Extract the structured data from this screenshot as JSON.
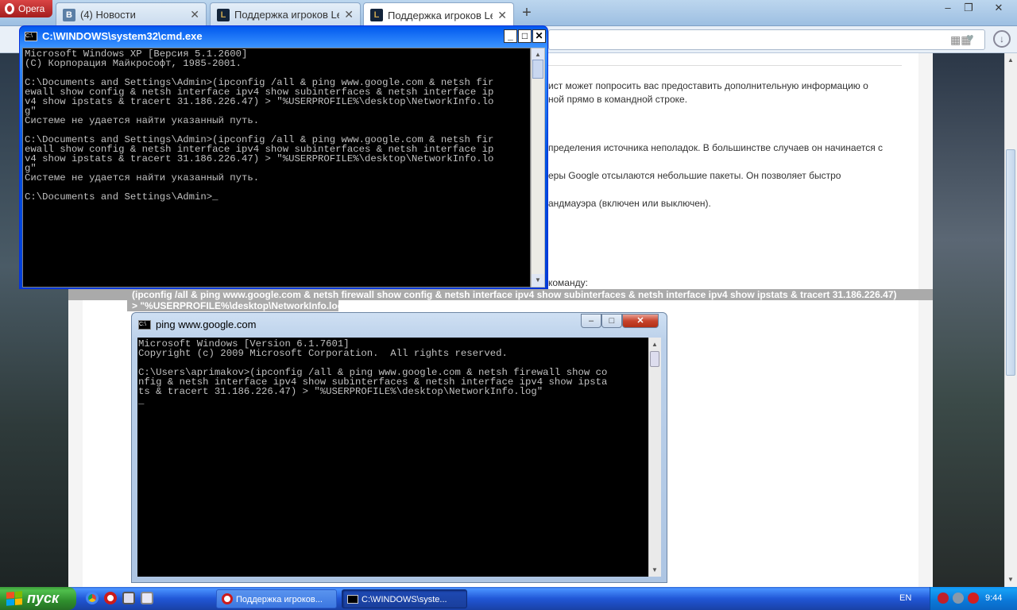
{
  "browser": {
    "menu_label": "Opera",
    "tabs": [
      {
        "title": "(4) Новости",
        "favicon": "В"
      },
      {
        "title": "Поддержка игроков Leag",
        "favicon": "L"
      },
      {
        "title": "Поддержка игроков Leag",
        "favicon": "L"
      }
    ],
    "close_glyph": "✕",
    "new_tab_glyph": "+",
    "window_controls": {
      "minimize": "–",
      "maximize": "❐",
      "close": "✕"
    }
  },
  "page": {
    "paragraphs": [
      "ист может попросить вас предоставить дополнительную информацию о",
      "ной прямо в командной строке.",
      "пределения источника неполадок. В большинстве случаев он начинается с",
      "еры Google отсылаются небольшие пакеты. Он позволяет быстро",
      "андмауэра (включен или выключен).",
      "команду:"
    ],
    "command_line1": "(ipconfig /all & ping www.google.com & netsh firewall show config & netsh interface ipv4 show subinterfaces & netsh interface ipv4 show ipstats & tracert 31.186.226.47)",
    "command_line2": "> \"%USERPROFILE%\\desktop\\NetworkInfo.log\""
  },
  "xp_window": {
    "title": "C:\\WINDOWS\\system32\\cmd.exe",
    "lines": [
      "Microsoft Windows XP [Версия 5.1.2600]",
      "(С) Корпорация Майкрософт, 1985-2001.",
      "",
      "C:\\Documents and Settings\\Admin>(ipconfig /all & ping www.google.com & netsh fir",
      "ewall show config & netsh interface ipv4 show subinterfaces & netsh interface ip",
      "v4 show ipstats & tracert 31.186.226.47) > \"%USERPROFILE%\\desktop\\NetworkInfo.lo",
      "g\"",
      "Системе не удается найти указанный путь.",
      "",
      "C:\\Documents and Settings\\Admin>(ipconfig /all & ping www.google.com & netsh fir",
      "ewall show config & netsh interface ipv4 show subinterfaces & netsh interface ip",
      "v4 show ipstats & tracert 31.186.226.47) > \"%USERPROFILE%\\desktop\\NetworkInfo.lo",
      "g\"",
      "Системе не удается найти указанный путь.",
      "",
      "C:\\Documents and Settings\\Admin>_"
    ]
  },
  "w7_window": {
    "title": "ping  www.google.com",
    "lines": [
      "Microsoft Windows [Version 6.1.7601]",
      "Copyright (c) 2009 Microsoft Corporation.  All rights reserved.",
      "",
      "C:\\Users\\aprimakov>(ipconfig /all & ping www.google.com & netsh firewall show co",
      "nfig & netsh interface ipv4 show subinterfaces & netsh interface ipv4 show ipsta",
      "ts & tracert 31.186.226.47) > \"%USERPROFILE%\\desktop\\NetworkInfo.log\"",
      "_"
    ]
  },
  "taskbar": {
    "start_label": "пуск",
    "buttons": [
      {
        "label": "Поддержка игроков..."
      },
      {
        "label": "C:\\WINDOWS\\syste..."
      }
    ],
    "language": "EN",
    "clock": "9:44"
  },
  "colors": {
    "console_text": "#c0c0c0",
    "console_bg": "#000000",
    "xp_blue": "#0050e0",
    "highlight": "#aaaaaa"
  }
}
